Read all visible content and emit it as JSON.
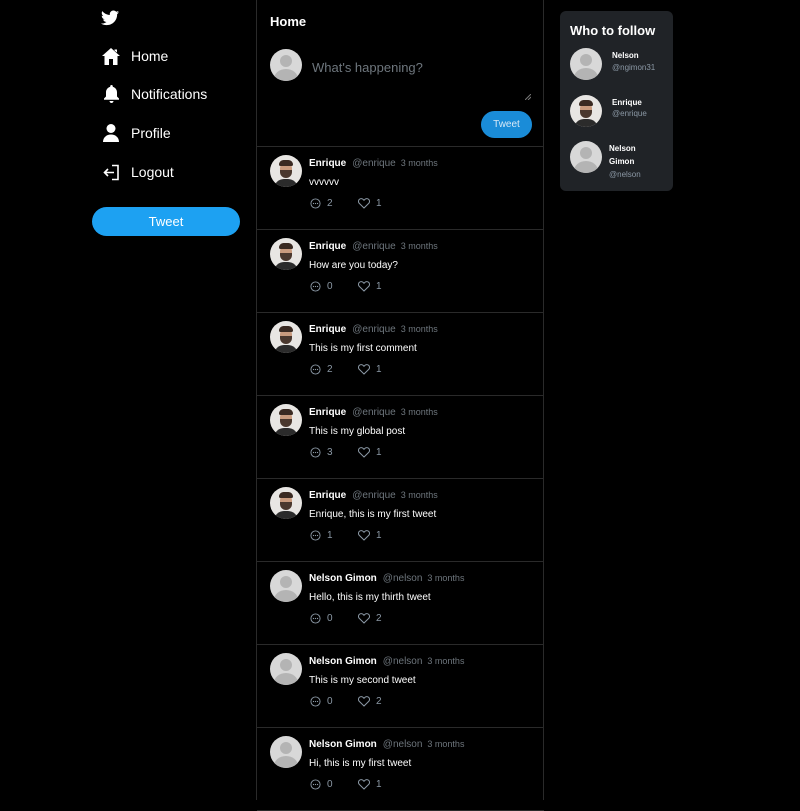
{
  "sidebar": {
    "logo_icon": "twitter-bird-icon",
    "items": [
      {
        "label": "Home",
        "icon": "home-icon"
      },
      {
        "label": "Notifications",
        "icon": "bell-icon"
      },
      {
        "label": "Profile",
        "icon": "user-icon"
      },
      {
        "label": "Logout",
        "icon": "logout-icon"
      }
    ],
    "tweet_button": "Tweet"
  },
  "main": {
    "title": "Home",
    "composer": {
      "placeholder": "What's happening?",
      "button": "Tweet"
    },
    "tweets": [
      {
        "name": "Enrique",
        "handle": "@enrique",
        "time": "3 months",
        "text": "vvvvvv",
        "replies": "2",
        "likes": "1"
      },
      {
        "name": "Enrique",
        "handle": "@enrique",
        "time": "3 months",
        "text": "How are you today?",
        "replies": "0",
        "likes": "1"
      },
      {
        "name": "Enrique",
        "handle": "@enrique",
        "time": "3 months",
        "text": "This is my first comment",
        "replies": "2",
        "likes": "1"
      },
      {
        "name": "Enrique",
        "handle": "@enrique",
        "time": "3 months",
        "text": "This is my global post",
        "replies": "3",
        "likes": "1"
      },
      {
        "name": "Enrique",
        "handle": "@enrique",
        "time": "3 months",
        "text": "Enrique, this is my first tweet",
        "replies": "1",
        "likes": "1"
      },
      {
        "name": "Nelson Gimon",
        "handle": "@nelson",
        "time": "3 months",
        "text": "Hello, this is my thirth tweet",
        "replies": "0",
        "likes": "2"
      },
      {
        "name": "Nelson Gimon",
        "handle": "@nelson",
        "time": "3 months",
        "text": "This is my second tweet",
        "replies": "0",
        "likes": "2"
      },
      {
        "name": "Nelson Gimon",
        "handle": "@nelson",
        "time": "3 months",
        "text": "Hi, this is my first tweet",
        "replies": "0",
        "likes": "1"
      }
    ]
  },
  "who_to_follow": {
    "title": "Who to follow",
    "users": [
      {
        "name": "Nelson",
        "handle": "@ngimon31"
      },
      {
        "name": "Enrique",
        "handle": "@enrique"
      },
      {
        "name": "Nelson Gimon",
        "name_line1": "Nelson",
        "name_line2": "Gimon",
        "handle": "@nelson"
      }
    ]
  },
  "colors": {
    "background": "#000000",
    "accent": "#1da1f2",
    "composer_button": "#1a8cd8",
    "card": "#202327",
    "muted_text": "#6e767d",
    "divider": "#2a2a2a"
  }
}
